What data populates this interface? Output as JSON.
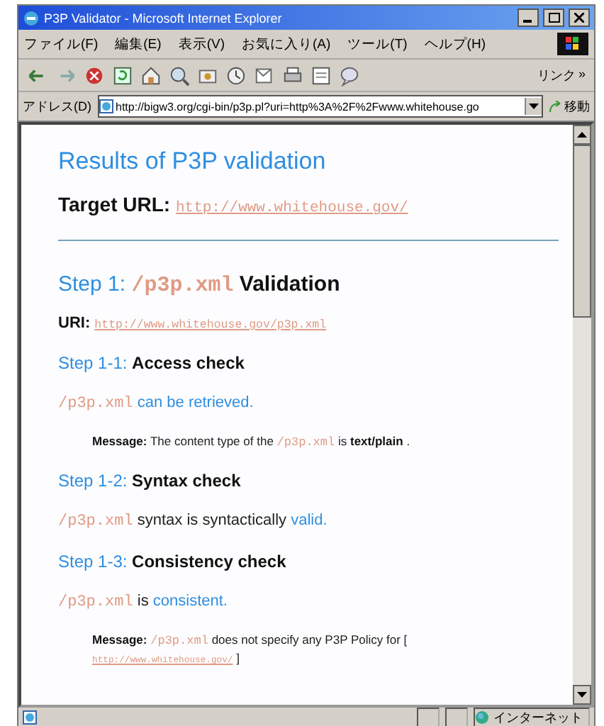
{
  "window": {
    "title": "P3P Validator - Microsoft Internet Explorer"
  },
  "menu": [
    "ファイル(F)",
    "編集(E)",
    "表示(V)",
    "お気に入り(A)",
    "ツール(T)",
    "ヘルプ(H)"
  ],
  "toolbar": {
    "links_label": "リンク",
    "links_more": "»"
  },
  "address_bar": {
    "label": "アドレス(D)",
    "value": "http://bigw3.org/cgi-bin/p3p.pl?uri=http%3A%2F%2Fwww.whitehouse.go",
    "go": "移動"
  },
  "content": [
    {
      "kind": "h1",
      "segments": [
        {
          "kind": "title",
          "text": "Results of P3P validation"
        }
      ]
    },
    {
      "kind": "target",
      "segments": [
        {
          "kind": "label",
          "text": "Target URL:"
        },
        {
          "kind": "link",
          "text": "http://www.whitehouse.gov/"
        }
      ]
    },
    {
      "kind": "rule"
    },
    {
      "kind": "h2",
      "segments": [
        {
          "kind": "step",
          "text": "Step 1:"
        },
        {
          "kind": "filename",
          "text": "/p3p.xml"
        },
        {
          "kind": "label",
          "text": "Validation"
        }
      ]
    },
    {
      "kind": "p",
      "segments": [
        {
          "kind": "label",
          "text": "URI:"
        },
        {
          "kind": "link",
          "text": "http://www.whitehouse.gov/p3p.xml"
        }
      ]
    },
    {
      "kind": "h3",
      "segments": [
        {
          "kind": "step",
          "text": "Step 1-1:"
        },
        {
          "kind": "label",
          "text": "Access check"
        }
      ]
    },
    {
      "kind": "p",
      "segments": [
        {
          "kind": "filename",
          "text": "/p3p.xml"
        },
        {
          "kind": "result",
          "text": "can be retrieved."
        }
      ]
    },
    {
      "kind": "message",
      "segments": [
        {
          "kind": "label",
          "text": "Message:"
        },
        {
          "kind": "text",
          "text": "The content type of the"
        },
        {
          "kind": "filename",
          "text": "/p3p.xml"
        },
        {
          "kind": "text",
          "text": "is"
        },
        {
          "kind": "label",
          "text": "text/plain"
        },
        {
          "kind": "text",
          "text": "."
        }
      ]
    },
    {
      "kind": "h3",
      "segments": [
        {
          "kind": "step",
          "text": "Step 1-2:"
        },
        {
          "kind": "label",
          "text": "Syntax check"
        }
      ]
    },
    {
      "kind": "p",
      "segments": [
        {
          "kind": "filename",
          "text": "/p3p.xml"
        },
        {
          "kind": "text",
          "text": "syntax is syntactically"
        },
        {
          "kind": "result",
          "text": "valid."
        }
      ]
    },
    {
      "kind": "h3",
      "segments": [
        {
          "kind": "step",
          "text": "Step 1-3:"
        },
        {
          "kind": "label",
          "text": "Consistency check"
        }
      ]
    },
    {
      "kind": "p",
      "segments": [
        {
          "kind": "filename",
          "text": "/p3p.xml"
        },
        {
          "kind": "text",
          "text": "is"
        },
        {
          "kind": "result",
          "text": "consistent."
        }
      ]
    },
    {
      "kind": "message",
      "segments": [
        {
          "kind": "label",
          "text": "Message:"
        },
        {
          "kind": "filename",
          "text": "/p3p.xml"
        },
        {
          "kind": "text",
          "text": "does not specify any P3P Policy for"
        },
        {
          "kind": "text",
          "text": "["
        },
        {
          "kind": "link",
          "text": "http://www.whitehouse.gov/"
        },
        {
          "kind": "text",
          "text": "]"
        }
      ]
    }
  ],
  "status_bar": {
    "zone": "インターネット"
  }
}
